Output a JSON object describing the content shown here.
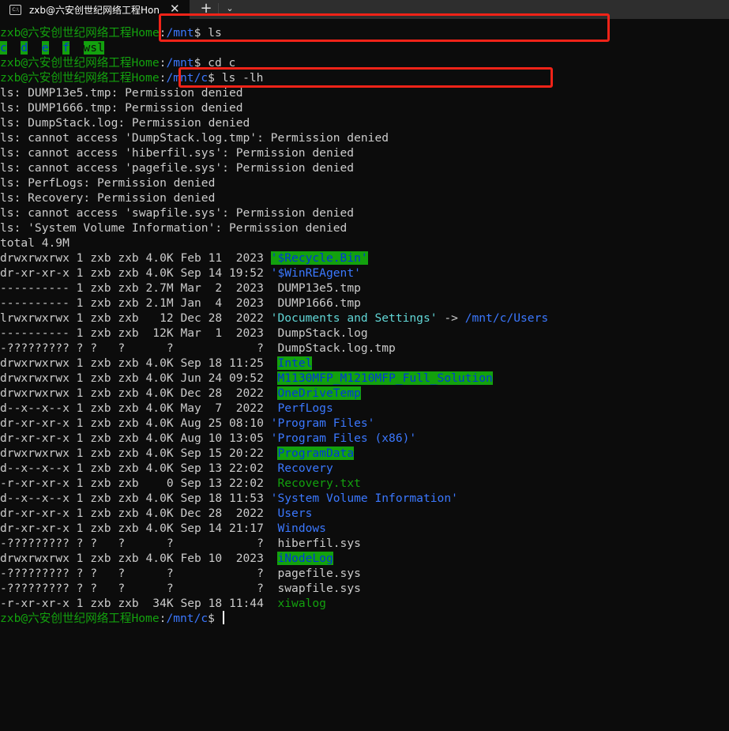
{
  "window": {
    "tab_title": "zxb@六安创世纪网络工程Hon",
    "tab_icon": "terminal-icon",
    "close_glyph": "✕",
    "new_tab_glyph": "+",
    "dropdown_glyph": "⌄"
  },
  "prompt": {
    "user_host": "zxb@六安创世纪网络工程Home",
    "colon": ":",
    "dollar": "$"
  },
  "commands": [
    {
      "path": "/mnt",
      "cmd": " ls"
    },
    {
      "path": "/mnt",
      "cmd": " cd c"
    },
    {
      "path": "/mnt/c",
      "cmd": " ls -lh"
    }
  ],
  "ls_mnt": [
    "c",
    "d",
    "e",
    "f",
    "wsl"
  ],
  "errors": [
    "ls: DUMP13e5.tmp: Permission denied",
    "ls: DUMP1666.tmp: Permission denied",
    "ls: DumpStack.log: Permission denied",
    "ls: cannot access 'DumpStack.log.tmp': Permission denied",
    "ls: cannot access 'hiberfil.sys': Permission denied",
    "ls: cannot access 'pagefile.sys': Permission denied",
    "ls: PerfLogs: Permission denied",
    "ls: Recovery: Permission denied",
    "ls: cannot access 'swapfile.sys': Permission denied",
    "ls: 'System Volume Information': Permission denied"
  ],
  "total": "total 4.9M",
  "entries": [
    {
      "meta": "drwxrwxrwx 1 zxb zxb 4.0K Feb 11  2023 ",
      "name": "'$Recycle.Bin'",
      "style": "bg-g"
    },
    {
      "meta": "dr-xr-xr-x 1 zxb zxb 4.0K Sep 14 19:52 ",
      "name": "'$WinREAgent'",
      "style": "b"
    },
    {
      "meta": "---------- 1 zxb zxb 2.7M Mar  2  2023 ",
      "name": " DUMP13e5.tmp",
      "style": "w"
    },
    {
      "meta": "---------- 1 zxb zxb 2.1M Jan  4  2023 ",
      "name": " DUMP1666.tmp",
      "style": "w"
    },
    {
      "meta": "lrwxrwxrwx 1 zxb zxb   12 Dec 28  2022 ",
      "name": "'Documents and Settings'",
      "style": "cy",
      "arrow": " -> ",
      "target": "/mnt/c/Users"
    },
    {
      "meta": "---------- 1 zxb zxb  12K Mar  1  2023 ",
      "name": " DumpStack.log",
      "style": "w"
    },
    {
      "meta": "-????????? ? ?   ?      ?            ? ",
      "name": " DumpStack.log.tmp",
      "style": "w"
    },
    {
      "meta": "drwxrwxrwx 1 zxb zxb 4.0K Sep 18 11:25 ",
      "name": " ",
      "name2": "Intel",
      "style": "bg-g"
    },
    {
      "meta": "drwxrwxrwx 1 zxb zxb 4.0K Jun 24 09:52 ",
      "name": " ",
      "name2": "M1130MFP_M1210MFP_Full_Solution",
      "style": "bg-g"
    },
    {
      "meta": "drwxrwxrwx 1 zxb zxb 4.0K Dec 28  2022 ",
      "name": " ",
      "name2": "OneDriveTemp",
      "style": "bg-g"
    },
    {
      "meta": "d--x--x--x 1 zxb zxb 4.0K May  7  2022 ",
      "name": " PerfLogs",
      "style": "b"
    },
    {
      "meta": "dr-xr-xr-x 1 zxb zxb 4.0K Aug 25 08:10 ",
      "name": "'Program Files'",
      "style": "b"
    },
    {
      "meta": "dr-xr-xr-x 1 zxb zxb 4.0K Aug 10 13:05 ",
      "name": "'Program Files (x86)'",
      "style": "b"
    },
    {
      "meta": "drwxrwxrwx 1 zxb zxb 4.0K Sep 15 20:22 ",
      "name": " ",
      "name2": "ProgramData",
      "style": "bg-g"
    },
    {
      "meta": "d--x--x--x 1 zxb zxb 4.0K Sep 13 22:02 ",
      "name": " Recovery",
      "style": "b"
    },
    {
      "meta": "-r-xr-xr-x 1 zxb zxb    0 Sep 13 22:02 ",
      "name": " Recovery.txt",
      "style": "g"
    },
    {
      "meta": "d--x--x--x 1 zxb zxb 4.0K Sep 18 11:53 ",
      "name": "'System Volume Information'",
      "style": "b"
    },
    {
      "meta": "dr-xr-xr-x 1 zxb zxb 4.0K Dec 28  2022 ",
      "name": " Users",
      "style": "b"
    },
    {
      "meta": "dr-xr-xr-x 1 zxb zxb 4.0K Sep 14 21:17 ",
      "name": " Windows",
      "style": "b"
    },
    {
      "meta": "-????????? ? ?   ?      ?            ? ",
      "name": " hiberfil.sys",
      "style": "w"
    },
    {
      "meta": "drwxrwxrwx 1 zxb zxb 4.0K Feb 10  2023 ",
      "name": " ",
      "name2": "iNodeLog",
      "style": "bg-g"
    },
    {
      "meta": "-????????? ? ?   ?      ?            ? ",
      "name": " pagefile.sys",
      "style": "w"
    },
    {
      "meta": "-????????? ? ?   ?      ?            ? ",
      "name": " swapfile.sys",
      "style": "w"
    },
    {
      "meta": "-r-xr-xr-x 1 zxb zxb  34K Sep 18 11:44 ",
      "name": " xiwalog",
      "style": "g"
    }
  ],
  "final_prompt": {
    "path": "/mnt/c"
  },
  "colors": {
    "prompt_green": "#13a10e",
    "path_blue": "#3b78ff",
    "symlink_cyan": "#61d6d6",
    "text_gray": "#cccccc",
    "highlight_green_bg": "#13a10e",
    "annotation_red": "#f02318",
    "background": "#0c0c0c"
  }
}
